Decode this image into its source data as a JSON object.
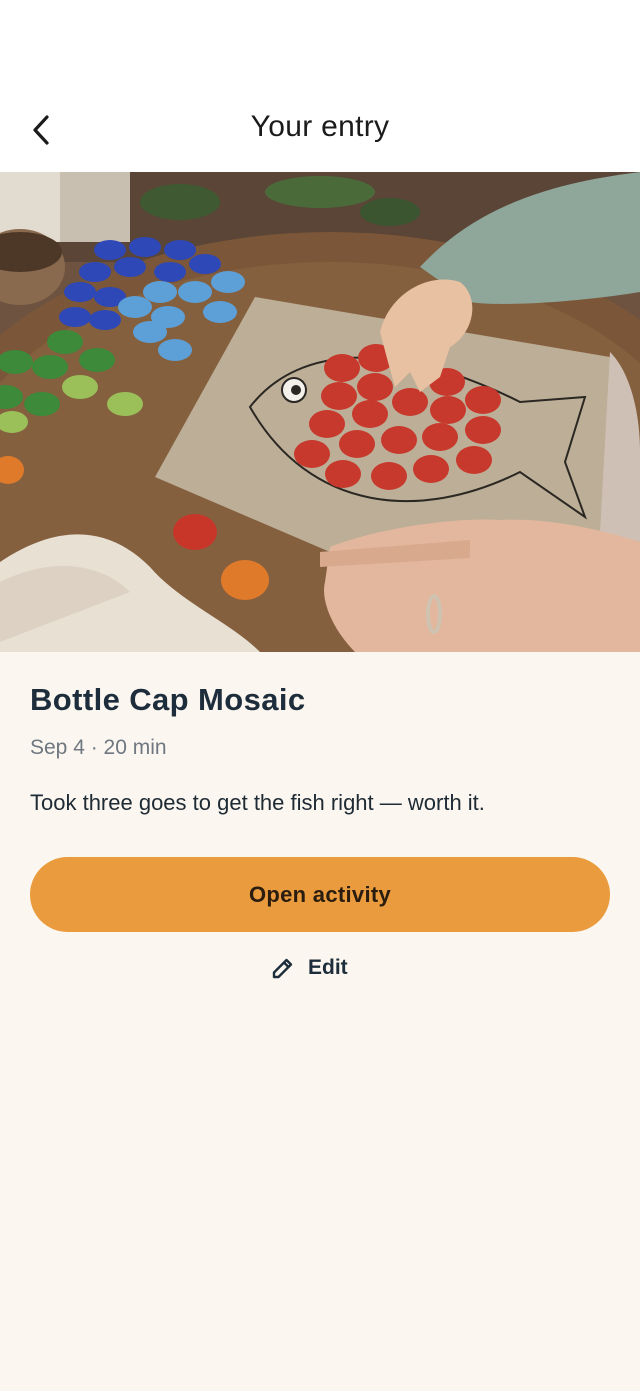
{
  "header": {
    "title": "Your entry",
    "back_icon": "chevron-left-icon"
  },
  "hero": {
    "description_icon": "bottle-cap-fish-photo"
  },
  "entry": {
    "title": "Bottle Cap Mosaic",
    "meta": "Sep 4 · 20 min",
    "note": "Took three goes to get the fish right — worth it."
  },
  "actions": {
    "open_label": "Open activity",
    "edit_label": "Edit",
    "edit_icon": "pencil-icon"
  },
  "colors": {
    "background": "#FBF7F0",
    "accent": "#E99B3D",
    "title_text": "#1D2D3B",
    "meta_text": "#6F7780"
  }
}
